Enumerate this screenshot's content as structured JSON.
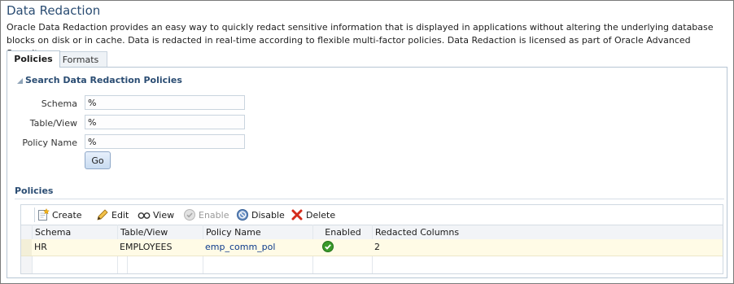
{
  "page": {
    "title": "Data Redaction",
    "description": "Oracle Data Redaction provides an easy way to quickly redact sensitive information that is displayed in applications without altering the underlying database blocks on disk or in cache. Data is redacted in real-time according to flexible multi-factor policies. Data Redaction is licensed as part of Oracle Advanced Security."
  },
  "tabs": [
    {
      "label": "Policies",
      "active": true
    },
    {
      "label": "Formats",
      "active": false
    }
  ],
  "search": {
    "header": "Search Data Redaction Policies",
    "fields": [
      {
        "label": "Schema",
        "value": "%"
      },
      {
        "label": "Table/View",
        "value": "%"
      },
      {
        "label": "Policy Name",
        "value": "%"
      }
    ],
    "go_label": "Go"
  },
  "policies": {
    "header": "Policies",
    "toolbar": [
      {
        "label": "Create",
        "icon": "create-icon",
        "enabled": true
      },
      {
        "label": "Edit",
        "icon": "pencil-icon",
        "enabled": true
      },
      {
        "label": "View",
        "icon": "glasses-icon",
        "enabled": true
      },
      {
        "label": "Enable",
        "icon": "check-circle-icon",
        "enabled": false
      },
      {
        "label": "Disable",
        "icon": "disable-circle-icon",
        "enabled": true
      },
      {
        "label": "Delete",
        "icon": "red-x-icon",
        "enabled": true
      }
    ],
    "columns": [
      "Schema",
      "Table/View",
      "Policy Name",
      "Enabled",
      "Redacted Columns"
    ],
    "rows": [
      {
        "schema": "HR",
        "table_view": "EMPLOYEES",
        "policy_name": "emp_comm_pol",
        "enabled": true,
        "redacted_columns": "2"
      }
    ]
  },
  "colors": {
    "title": "#2b4d73",
    "link": "#0d3b8c",
    "selected_row": "#fffbe6",
    "enabled_check": "#3a9a2a",
    "delete_red": "#d42a1a"
  }
}
